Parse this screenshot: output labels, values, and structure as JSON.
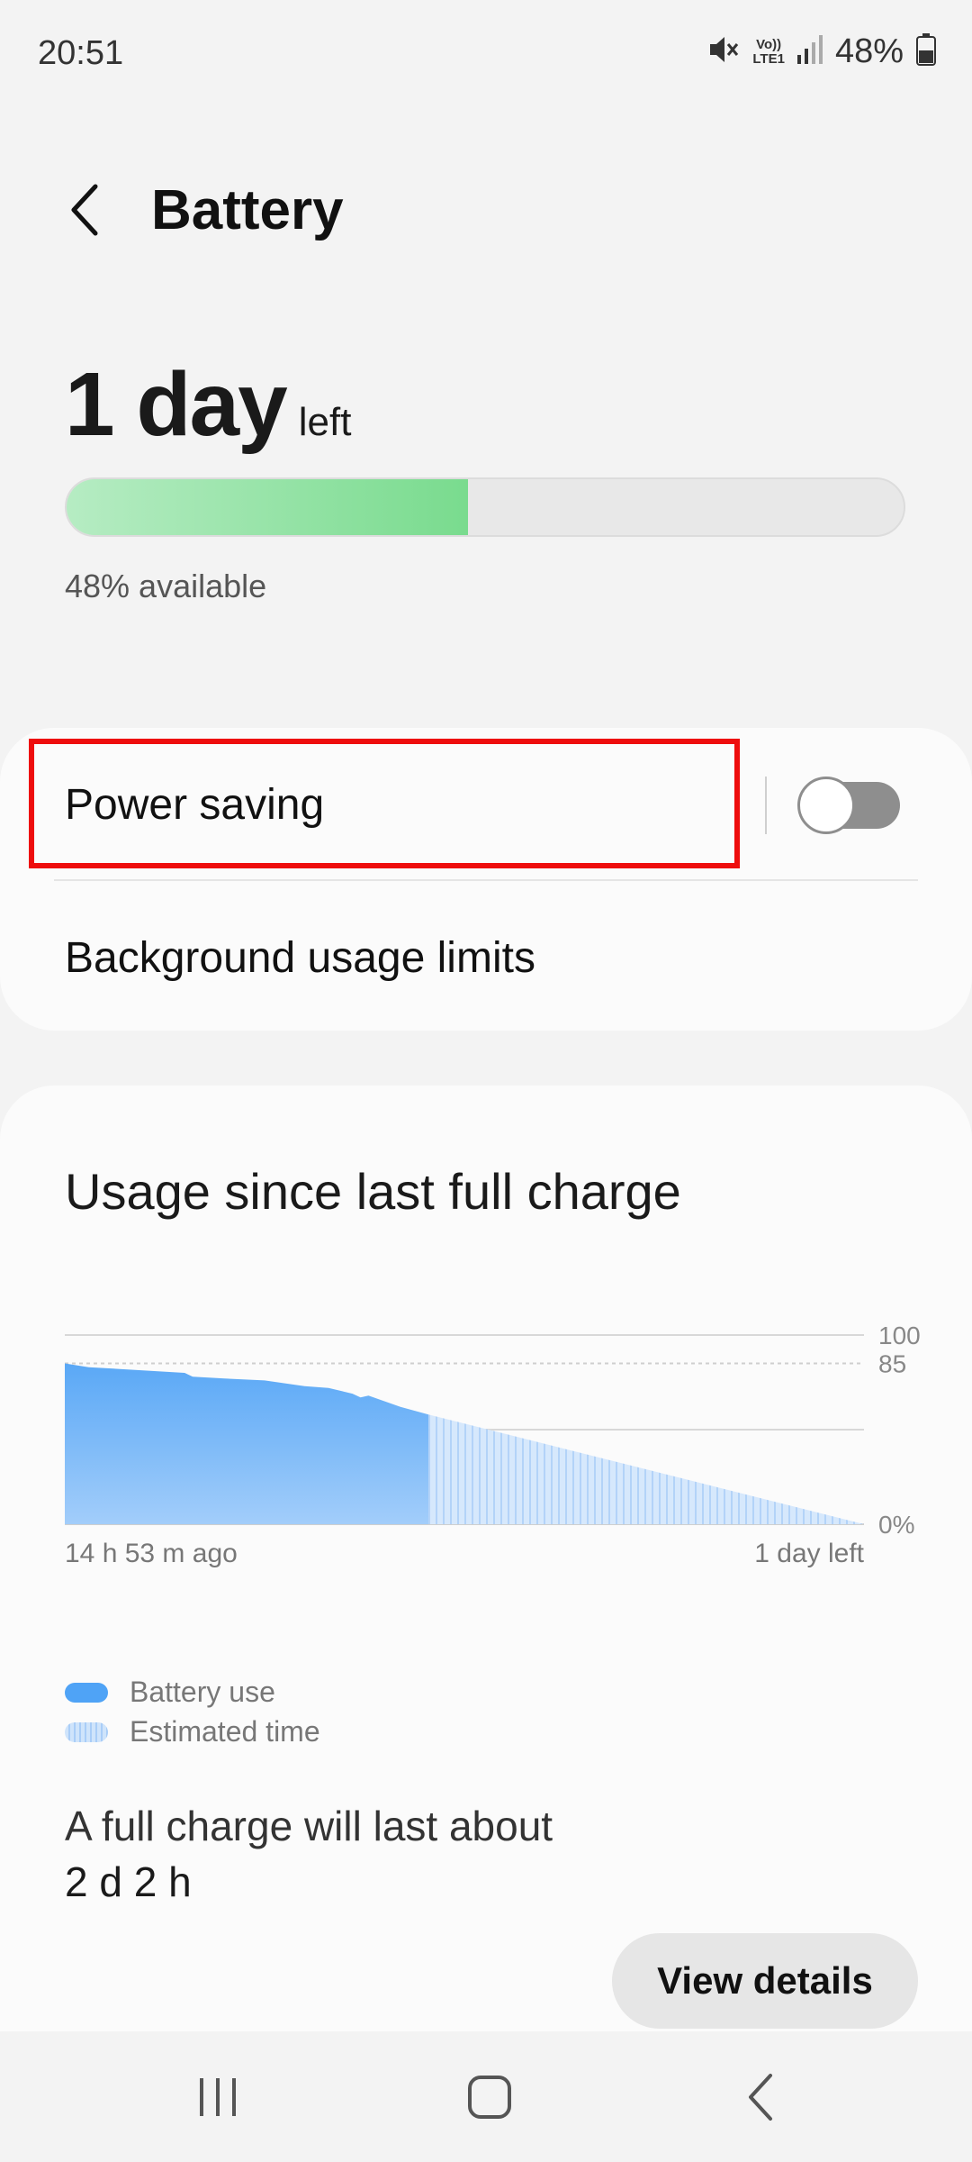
{
  "status_bar": {
    "time": "20:51",
    "network": [
      "Vo))",
      "LTE1"
    ],
    "battery_percent": "48%",
    "icons": [
      "mute-icon",
      "volte-icon",
      "signal-icon",
      "battery-icon"
    ]
  },
  "header": {
    "title": "Battery",
    "back_icon": "back-arrow-icon"
  },
  "summary": {
    "time_left_value": "1 day",
    "time_left_unit": "left",
    "level_fraction": 0.48,
    "available_text": "48% available"
  },
  "settings": {
    "power_saving_label": "Power saving",
    "power_saving_enabled": false,
    "background_limits_label": "Background usage limits"
  },
  "usage": {
    "title": "Usage since last full charge",
    "legend": {
      "battery_use": "Battery use",
      "estimated_time": "Estimated time"
    },
    "full_charge_label": "A full charge will last about",
    "full_charge_value": "2 d 2 h",
    "view_details_label": "View details"
  },
  "chart_data": {
    "type": "area",
    "y_ticks": [
      "100",
      "85",
      "0%"
    ],
    "x_labels": [
      "14 h 53 m ago",
      "1 day left"
    ],
    "ylim": [
      0,
      100
    ],
    "series": [
      {
        "name": "Battery use",
        "points": [
          [
            0,
            85
          ],
          [
            0.03,
            83
          ],
          [
            0.15,
            80
          ],
          [
            0.16,
            78
          ],
          [
            0.2,
            77
          ],
          [
            0.25,
            76
          ],
          [
            0.3,
            73
          ],
          [
            0.33,
            72
          ],
          [
            0.35,
            70
          ],
          [
            0.36,
            69
          ],
          [
            0.37,
            67
          ],
          [
            0.38,
            68
          ],
          [
            0.4,
            65
          ],
          [
            0.42,
            62
          ],
          [
            0.455,
            58
          ]
        ]
      },
      {
        "name": "Estimated time",
        "points": [
          [
            0.455,
            58
          ],
          [
            1,
            0
          ]
        ]
      }
    ],
    "grid": true
  },
  "nav": {
    "icons": [
      "recent-apps-icon",
      "home-icon",
      "back-icon"
    ]
  }
}
